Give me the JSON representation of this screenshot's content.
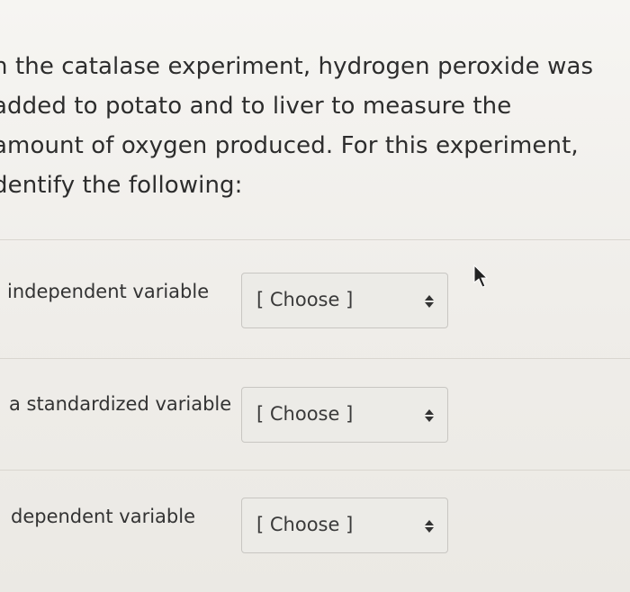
{
  "question": {
    "lines": [
      "n the catalase experiment, hydrogen peroxide was",
      "added to potato and to liver to measure the",
      "amount of oxygen produced.  For this experiment,",
      "dentify the following:"
    ]
  },
  "rows": [
    {
      "label": "independent variable",
      "select_value": "[ Choose ]"
    },
    {
      "label": "a standardized variable",
      "select_value": "[ Choose ]"
    },
    {
      "label": "dependent variable",
      "select_value": "[ Choose ]"
    }
  ],
  "icons": {
    "select_arrows": "up-down-arrows-icon",
    "cursor": "mouse-pointer-icon"
  }
}
